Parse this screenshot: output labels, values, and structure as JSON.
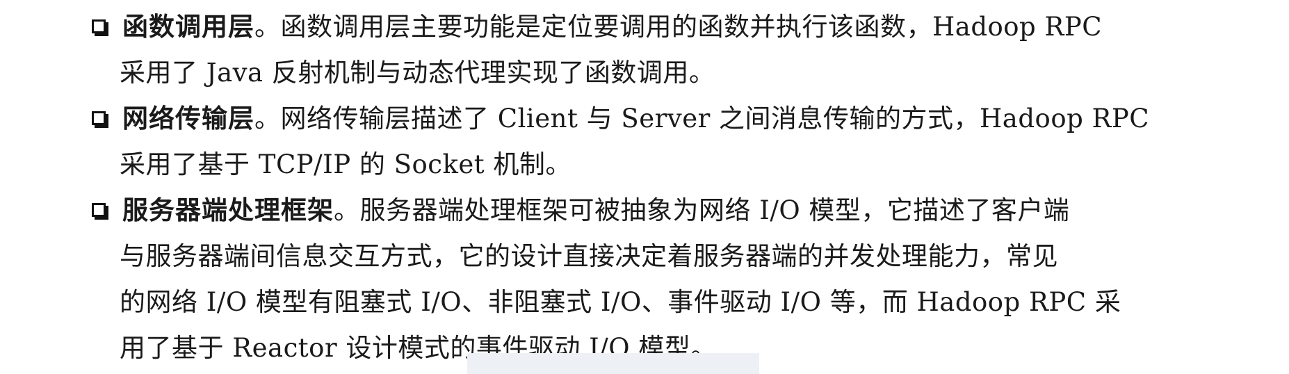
{
  "items": [
    {
      "term": "函数调用层",
      "lines": [
        "。函数调用层主要功能是定位要调用的函数并执行该函数，Hadoop RPC",
        "采用了 Java 反射机制与动态代理实现了函数调用。"
      ]
    },
    {
      "term": "网络传输层",
      "lines": [
        "。网络传输层描述了 Client 与 Server 之间消息传输的方式，Hadoop RPC",
        "采用了基于 TCP/IP 的 Socket 机制。"
      ]
    },
    {
      "term": "服务器端处理框架",
      "lines": [
        "。服务器端处理框架可被抽象为网络 I/O 模型，它描述了客户端",
        "与服务器端间信息交互方式，它的设计直接决定着服务器端的并发处理能力，常见",
        "的网络 I/O 模型有阻塞式 I/O、非阻塞式 I/O、事件驱动 I/O 等，而 Hadoop RPC 采",
        "用了基于 Reactor 设计模式的事件驱动 I/O 模型。"
      ]
    }
  ]
}
